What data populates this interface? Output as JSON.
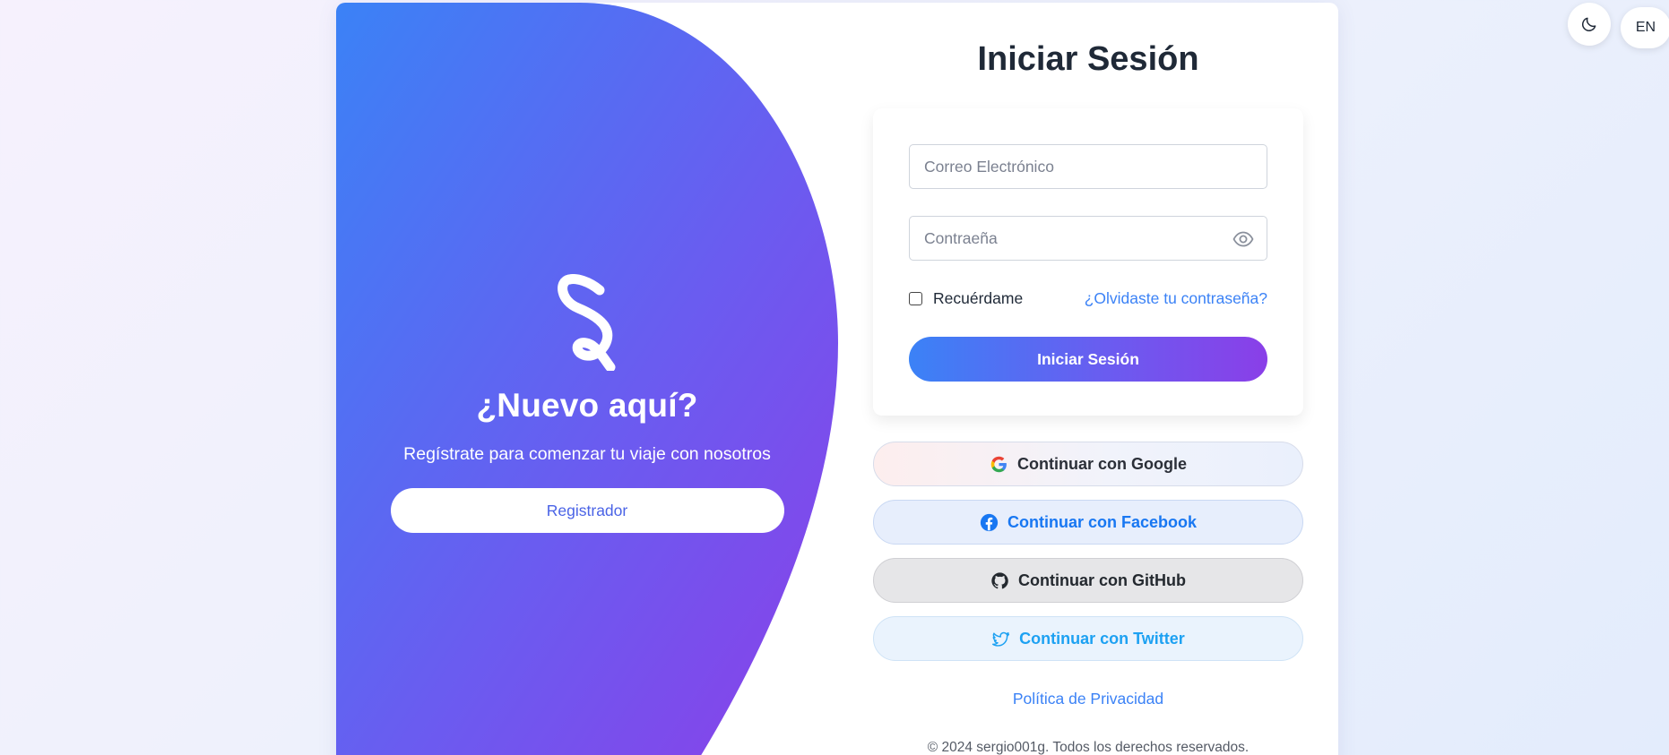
{
  "colors": {
    "accent_blue": "#3b82f6",
    "accent_purple": "#8a3fe8",
    "facebook_blue": "#1877f2",
    "twitter_blue": "#1da1f2"
  },
  "topbar": {
    "theme_icon": "moon-icon",
    "lang_label": "EN"
  },
  "left": {
    "logo_icon": "logo-icon",
    "title": "¿Nuevo aquí?",
    "subtitle": "Regístrate para comenzar tu viaje con nosotros",
    "register_label": "Registrador"
  },
  "login": {
    "title": "Iniciar Sesión",
    "email_placeholder": "Correo Electrónico",
    "password_placeholder": "Contraeña",
    "password_icon": "eye-icon",
    "remember_label": "Recuérdame",
    "remember_checked": false,
    "forgot_label": "¿Olvidaste tu contraseña?",
    "submit_label": "Iniciar Sesión"
  },
  "social": [
    {
      "label": "Continuar con Google",
      "icon": "google-icon"
    },
    {
      "label": "Continuar con Facebook",
      "icon": "facebook-icon"
    },
    {
      "label": "Continuar con GitHub",
      "icon": "github-icon"
    },
    {
      "label": "Continuar con Twitter",
      "icon": "twitter-icon"
    }
  ],
  "footer": {
    "privacy_label": "Política de Privacidad",
    "copyright": "© 2024 sergio001g. Todos los derechos reservados."
  }
}
